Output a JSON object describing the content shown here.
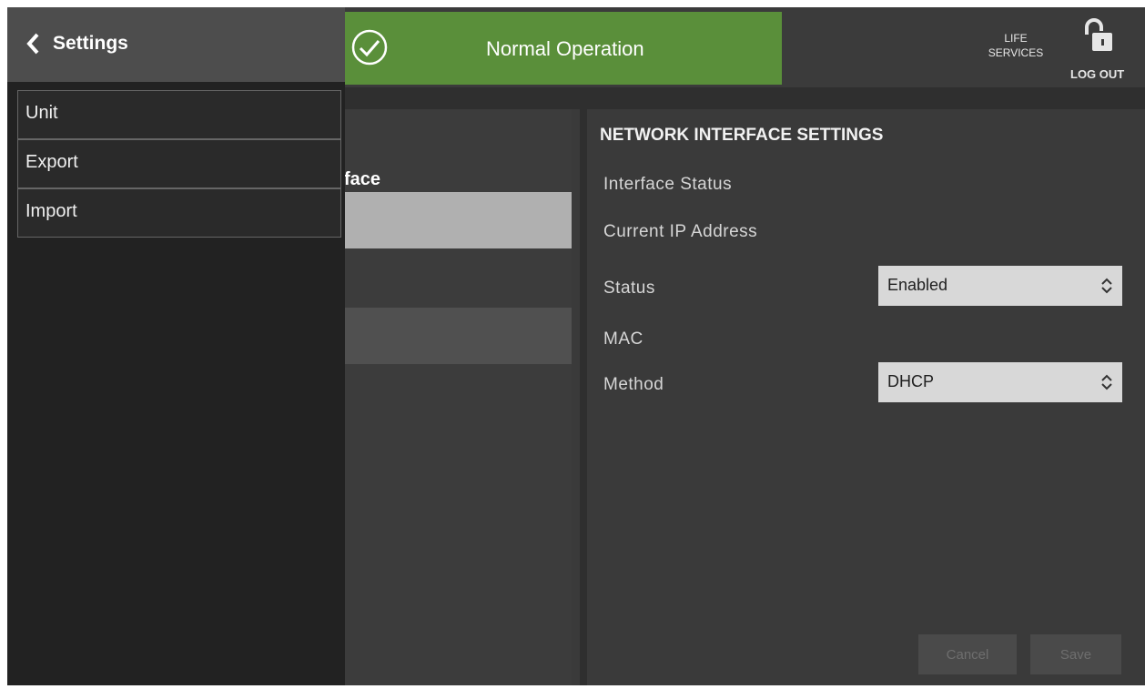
{
  "status_banner": {
    "text": "Normal Operation",
    "icon": "check-circle-icon",
    "color": "#5a8f3a"
  },
  "header": {
    "life_services_line1": "LIFE",
    "life_services_line2": "SERVICES",
    "logout_label": "LOG OUT",
    "lock_icon": "unlocked-padlock-icon"
  },
  "background_list": {
    "header_fragment": "face"
  },
  "settings": {
    "title": "NETWORK INTERFACE SETTINGS",
    "interface_status_label": "Interface Status",
    "current_ip_label": "Current IP Address",
    "status_label": "Status",
    "status_value": "Enabled",
    "mac_label": "MAC",
    "method_label": "Method",
    "method_value": "DHCP",
    "cancel_label": "Cancel",
    "save_label": "Save"
  },
  "drawer": {
    "title": "Settings",
    "back_icon": "chevron-left-icon",
    "items": [
      {
        "label": "Unit"
      },
      {
        "label": "Export"
      },
      {
        "label": "Import"
      }
    ]
  }
}
